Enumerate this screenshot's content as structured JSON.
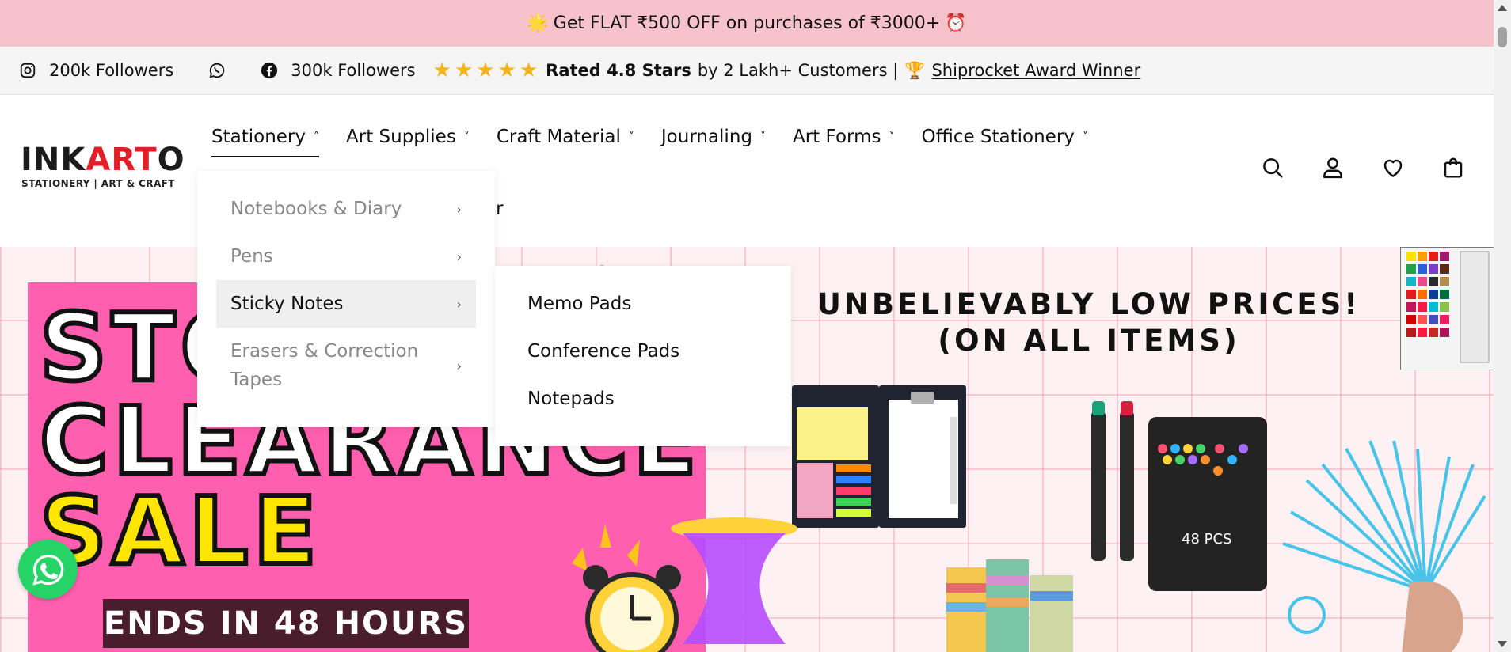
{
  "announcement": {
    "text": "Get FLAT ₹500 OFF on purchases of ₹3000+",
    "emoji_left": "🌟",
    "emoji_right": "⏰"
  },
  "social": {
    "instagram_followers": "200k Followers",
    "facebook_followers": "300k Followers",
    "rating_bold": "Rated 4.8 Stars",
    "rating_rest": "by 2 Lakh+ Customers |",
    "award_emoji": "🏆",
    "award_link": "Shiprocket Award Winner",
    "stars": 5
  },
  "logo": {
    "part_dark": "INK",
    "part_red": "ART",
    "part_dark2": "O",
    "tagline": "STATIONERY | ART & CRAFT"
  },
  "nav": {
    "items": [
      {
        "label": "Stationery",
        "chevron": "˄"
      },
      {
        "label": "Art Supplies",
        "chevron": "˅"
      },
      {
        "label": "Craft Material",
        "chevron": "˅"
      },
      {
        "label": "Journaling",
        "chevron": "˅"
      },
      {
        "label": "Art Forms",
        "chevron": "˅"
      },
      {
        "label": "Office Stationery",
        "chevron": "˅"
      }
    ],
    "second_row_partial": "er"
  },
  "dropdown": {
    "items": [
      {
        "label": "Notebooks & Diary"
      },
      {
        "label": "Pens"
      },
      {
        "label": "Sticky Notes"
      },
      {
        "label": "Erasers & Correction",
        "label2": "Tapes"
      }
    ],
    "arrow": "›"
  },
  "subdropdown": {
    "items": [
      "Memo Pads",
      "Conference Pads",
      "Notepads"
    ]
  },
  "hero": {
    "line1": "STO",
    "line2": "CLEARANCE",
    "line3": "SALE",
    "ends": "ENDS IN 48 HOURS",
    "headline1": "UNBELIEVABLY LOW PRICES!",
    "headline2": "(ON ALL ITEMS)",
    "marker_box_label": "48 PCS"
  },
  "colors": {
    "announce_bg": "#f8c2cd",
    "sale_pink": "#ff5fae",
    "sale_yellow": "#ffe600",
    "star": "#f2b418",
    "whatsapp": "#25d366"
  }
}
